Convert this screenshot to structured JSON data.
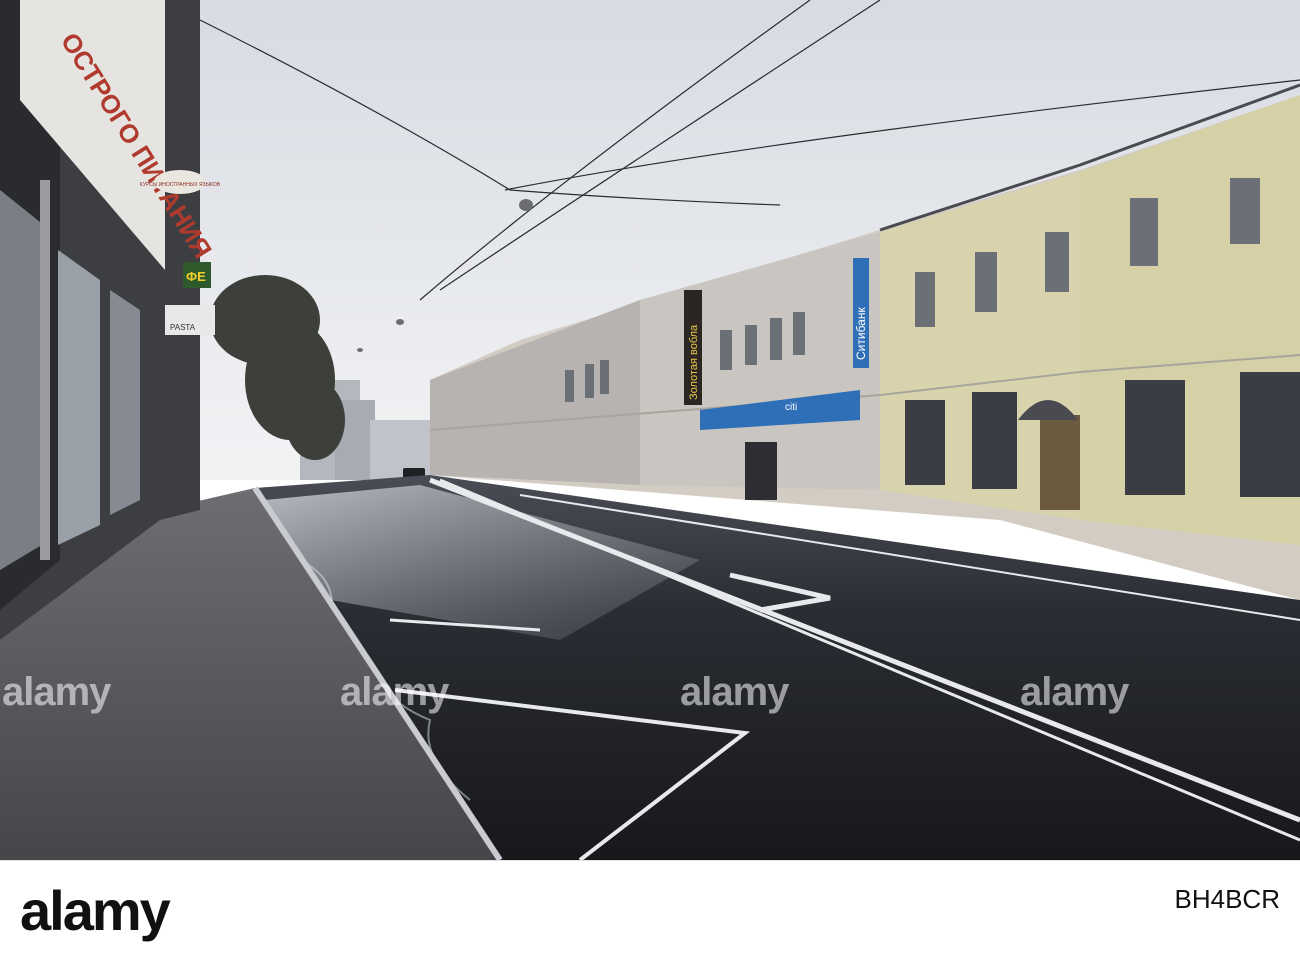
{
  "signs": {
    "shop_banner": "ОСТРОГО ПИТАНИЯ",
    "courses": "КУРСЫ ИНОСТРАННЫХ ЯЗЫКОВ",
    "pasta": "PASTA",
    "cafe": "ФЕ",
    "golden_vobla": "Золотая вобла",
    "citibank": "Ситибанк",
    "citi": "citi"
  },
  "watermarks": {
    "text": "alamy"
  },
  "footer": {
    "logo": "alamy",
    "image_id": "BH4BCR"
  },
  "colors": {
    "sky": "#eceef2",
    "asphalt": "#1d1f25",
    "sidewalk": "#56585c",
    "yellow_building": "#dcd6b3",
    "bank_blue": "#2f6fb8",
    "footer_bg": "#ffffff"
  }
}
